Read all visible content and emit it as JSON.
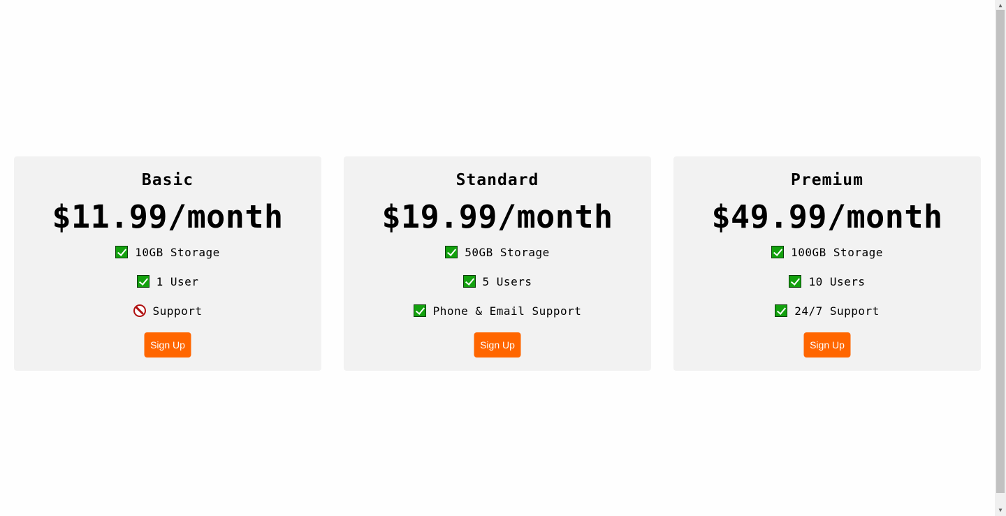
{
  "plans": [
    {
      "name": "Basic",
      "price": "$11.99/month",
      "features": [
        {
          "label": "10GB Storage",
          "icon": "check-icon"
        },
        {
          "label": "1 User",
          "icon": "check-icon"
        },
        {
          "label": "Support",
          "icon": "no-entry-icon"
        }
      ],
      "button_label": "Sign Up"
    },
    {
      "name": "Standard",
      "price": "$19.99/month",
      "features": [
        {
          "label": "50GB Storage",
          "icon": "check-icon"
        },
        {
          "label": "5 Users",
          "icon": "check-icon"
        },
        {
          "label": "Phone & Email Support",
          "icon": "check-icon"
        }
      ],
      "button_label": "Sign Up"
    },
    {
      "name": "Premium",
      "price": "$49.99/month",
      "features": [
        {
          "label": "100GB Storage",
          "icon": "check-icon"
        },
        {
          "label": "10 Users",
          "icon": "check-icon"
        },
        {
          "label": "24/7 Support",
          "icon": "check-icon"
        }
      ],
      "button_label": "Sign Up"
    }
  ],
  "colors": {
    "page_background": "#fefefe",
    "card_background": "#f2f2f2",
    "button_background": "#ff6600",
    "button_text": "#ffffff",
    "check_green": "#13a10e",
    "no_entry_red": "#b01010"
  },
  "scrollbar": {
    "up_arrow_icon": "▲",
    "down_arrow_icon": "▼"
  }
}
